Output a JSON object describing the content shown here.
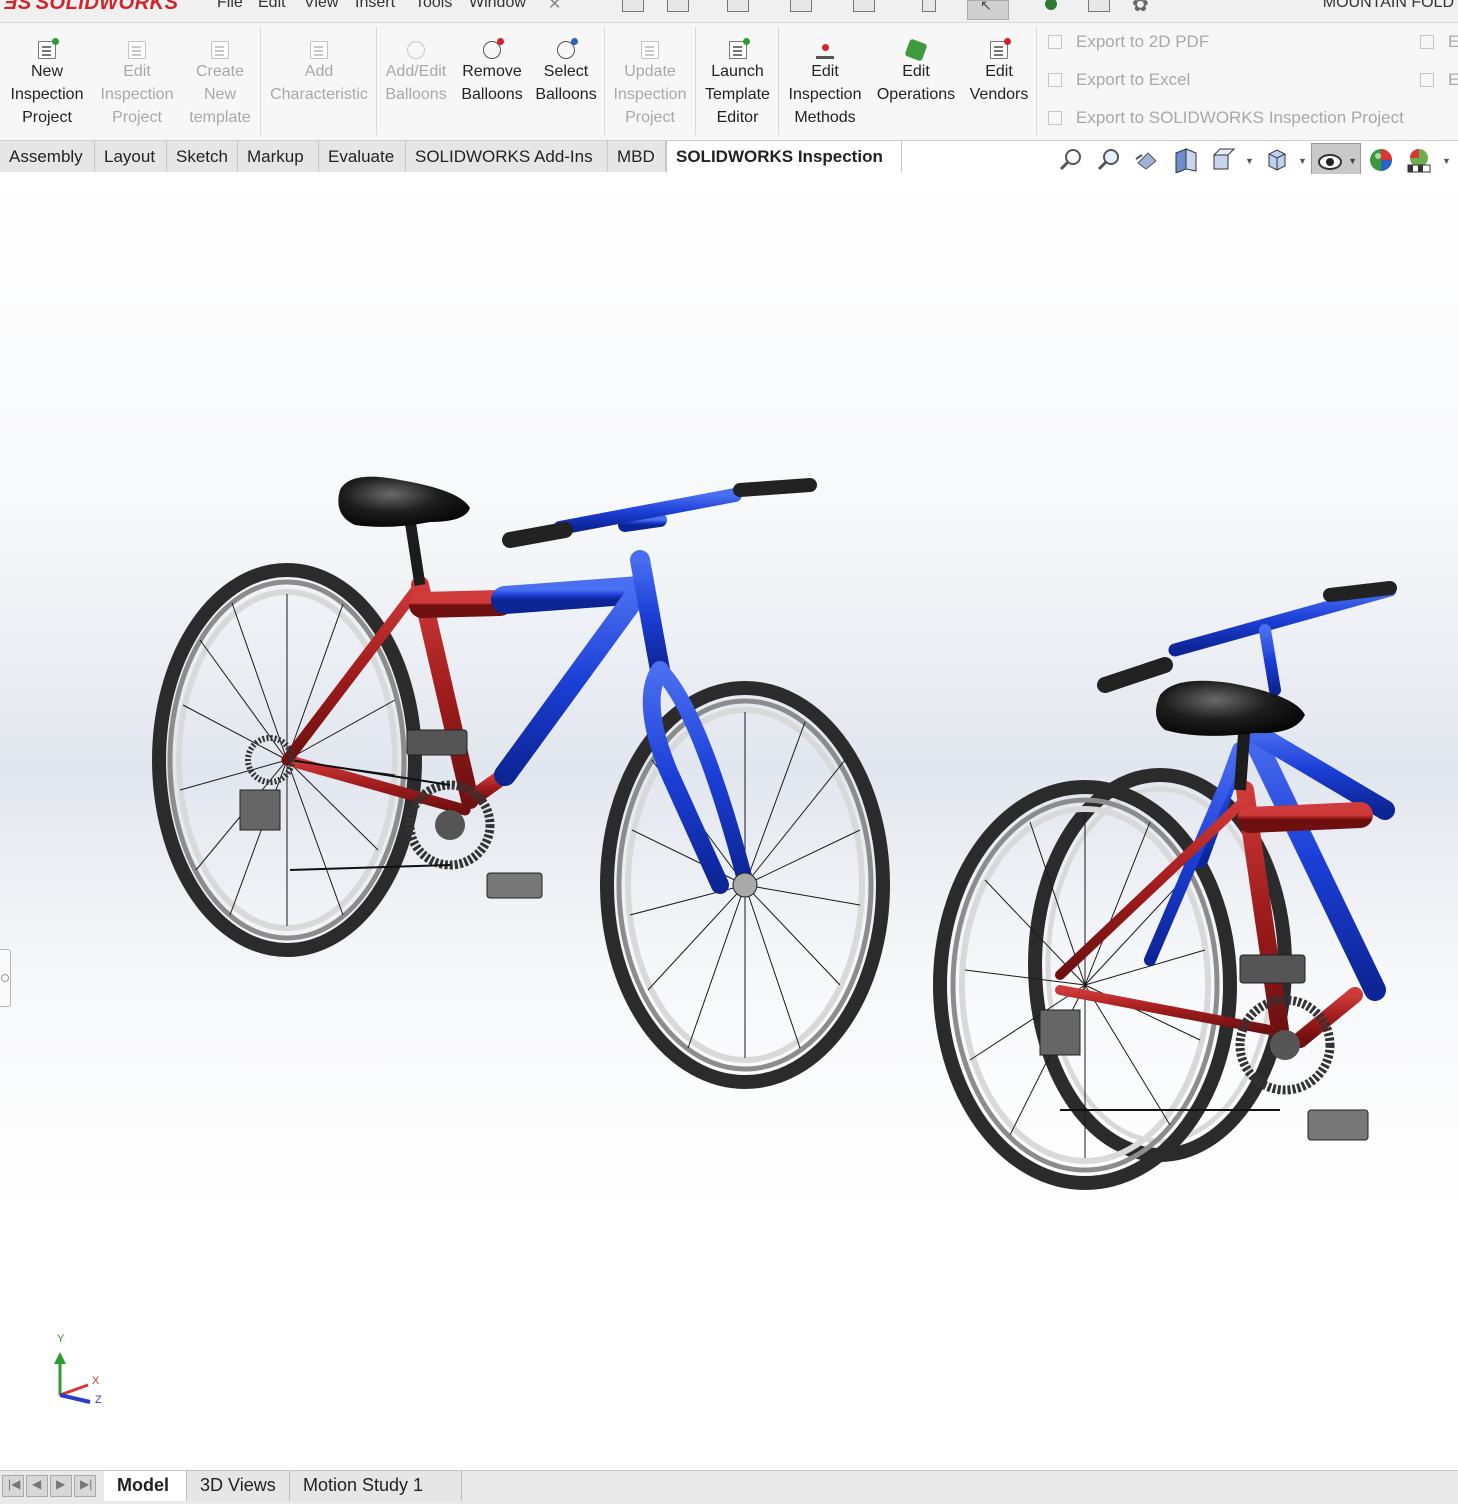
{
  "app": {
    "logo": "SOLIDWORKS",
    "menu": [
      "File",
      "Edit",
      "View",
      "Insert",
      "Tools",
      "Window"
    ],
    "document_title": "MOUNTAIN FOLD"
  },
  "ribbon": {
    "new_inspection_project": [
      "New",
      "Inspection",
      "Project"
    ],
    "edit_inspection_project": [
      "Edit",
      "Inspection",
      "Project"
    ],
    "create_new_template": [
      "Create",
      "New",
      "template"
    ],
    "add_characteristic": [
      "Add",
      "Characteristic"
    ],
    "add_edit_balloons": [
      "Add/Edit",
      "Balloons"
    ],
    "remove_balloons": [
      "Remove",
      "Balloons"
    ],
    "select_balloons": [
      "Select",
      "Balloons"
    ],
    "update_inspection_project": [
      "Update",
      "Inspection",
      "Project"
    ],
    "launch_template_editor": [
      "Launch",
      "Template",
      "Editor"
    ],
    "edit_inspection_methods": [
      "Edit",
      "Inspection",
      "Methods"
    ],
    "edit_operations": [
      "Edit",
      "Operations"
    ],
    "edit_vendors": [
      "Edit",
      "Vendors"
    ],
    "export": {
      "pdf": "Export to 2D PDF",
      "excel": "Export to Excel",
      "project": "Export to SOLIDWORKS Inspection Project",
      "truncated_1": "E",
      "truncated_2": "E"
    }
  },
  "tabs": [
    "Assembly",
    "Layout",
    "Sketch",
    "Markup",
    "Evaluate",
    "SOLIDWORKS Add-Ins",
    "MBD",
    "SOLIDWORKS Inspection"
  ],
  "active_tab": "SOLIDWORKS Inspection",
  "triad": {
    "y": "Y",
    "x": "X",
    "z": "Z"
  },
  "bottom_tabs": [
    "Model",
    "3D Views",
    "Motion Study 1"
  ],
  "active_bottom_tab": "Model",
  "colors": {
    "frame_blue": "#1e46d8",
    "frame_red": "#a51e1e",
    "logo_red": "#d2232a"
  }
}
